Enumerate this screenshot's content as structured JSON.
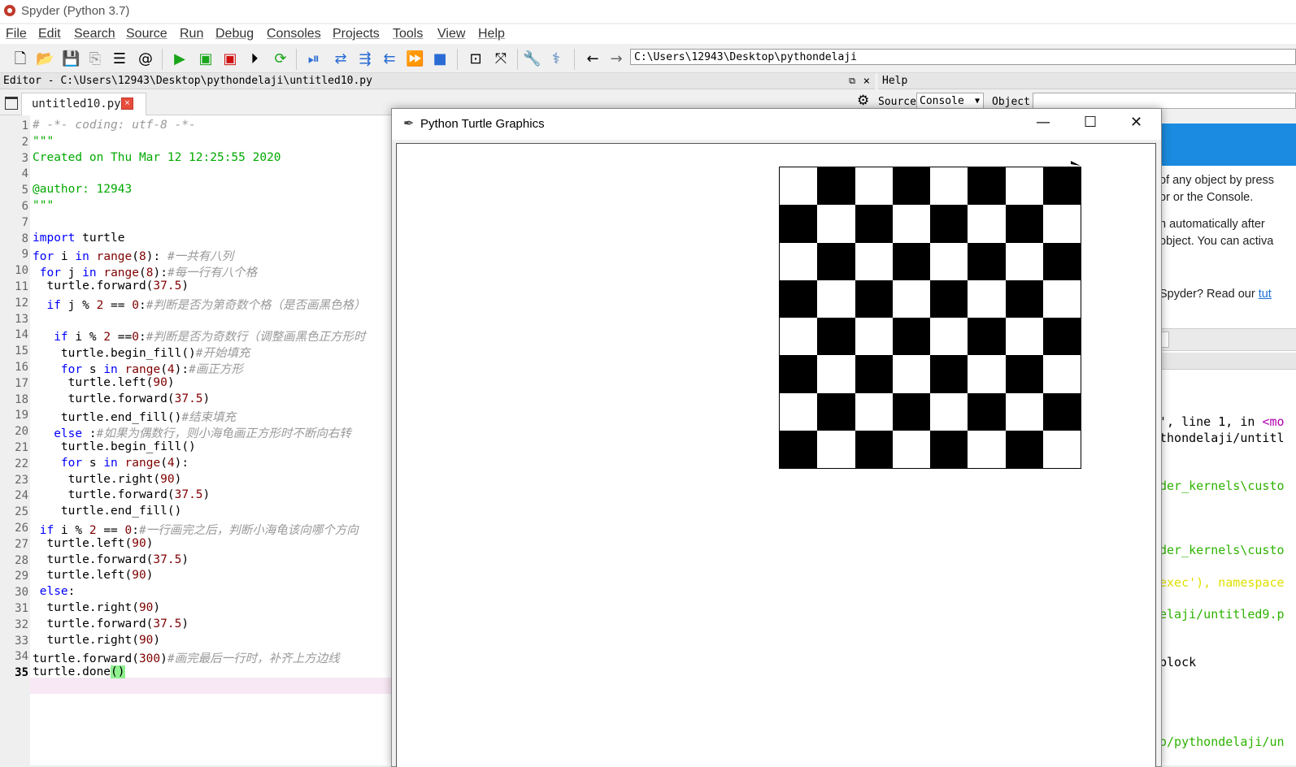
{
  "window": {
    "title": "Spyder (Python 3.7)"
  },
  "menu": [
    "File",
    "Edit",
    "Search",
    "Source",
    "Run",
    "Debug",
    "Consoles",
    "Projects",
    "Tools",
    "View",
    "Help"
  ],
  "toolbar": {
    "path": "C:\\Users\\12943\\Desktop\\pythondelaji",
    "icons": [
      "new-file-icon",
      "open-file-icon",
      "save-icon",
      "save-all-icon",
      "outline-icon",
      "at-icon",
      "run-icon",
      "run-cell-icon",
      "run-cell-advance-icon",
      "run-selection-icon",
      "rerun-icon",
      "debug-icon",
      "step-icon",
      "step-into-icon",
      "step-return-icon",
      "continue-icon",
      "stop-icon",
      "maximize-pane-icon",
      "fullscreen-icon",
      "preferences-icon",
      "python-path-icon",
      "back-icon",
      "forward-icon"
    ]
  },
  "editor": {
    "title": "Editor - C:\\Users\\12943\\Desktop\\pythondelaji\\untitled10.py",
    "tab_label": "untitled10.py",
    "current_line": 35,
    "lines": [
      "# -*- coding: utf-8 -*-",
      "\"\"\"",
      "Created on Thu Mar 12 12:25:55 2020",
      "",
      "@author: 12943",
      "\"\"\"",
      "",
      "import turtle",
      "for i in range(8): #一共有八列",
      " for j in range(8):#每一行有八个格",
      "  turtle.forward(37.5)",
      "  if j % 2 == 0:#判断是否为第奇数个格（是否画黑色格）",
      "",
      "   if i % 2 ==0:#判断是否为奇数行（调整画黑色正方形时",
      "    turtle.begin_fill()#开始填充",
      "    for s in range(4):#画正方形",
      "     turtle.left(90)",
      "     turtle.forward(37.5)",
      "    turtle.end_fill()#结束填充",
      "   else :#如果为偶数行，则小海龟画正方形时不断向右转",
      "    turtle.begin_fill()",
      "    for s in range(4):",
      "     turtle.right(90)",
      "     turtle.forward(37.5)",
      "    turtle.end_fill()",
      " if i % 2 == 0:#一行画完之后，判断小海龟该向哪个方向",
      "  turtle.left(90)",
      "  turtle.forward(37.5)",
      "  turtle.left(90)",
      " else:",
      "  turtle.right(90)",
      "  turtle.forward(37.5)",
      "  turtle.right(90)",
      "turtle.forward(300)#画完最后一行时，补齐上方边线",
      "turtle.done()"
    ]
  },
  "help": {
    "title": "Help",
    "source_label": "Source",
    "source_value": "Console",
    "object_label": "Object",
    "fragments": [
      "of any object by press",
      "or or the Console.",
      "n automatically after",
      "object. You can activa",
      "Spyder? Read our ",
      "tut"
    ]
  },
  "console_fragments": [
    "', line 1, in ",
    "<mo",
    "thondelaji/untitl",
    "der_kernels\\custo",
    "der_kernels\\custo",
    "exec'), namespace",
    "elaji/untitled9.p",
    " block",
    "o/pythondelaji/un"
  ],
  "turtle_window": {
    "title": "Python Turtle Graphics",
    "board_size": 8,
    "top_left_color": "white"
  },
  "colors": {
    "keyword": "#0000ff",
    "builtin": "#7f0000",
    "string": "#00aa00",
    "comment": "#999999",
    "accent": "#1a8be0"
  }
}
